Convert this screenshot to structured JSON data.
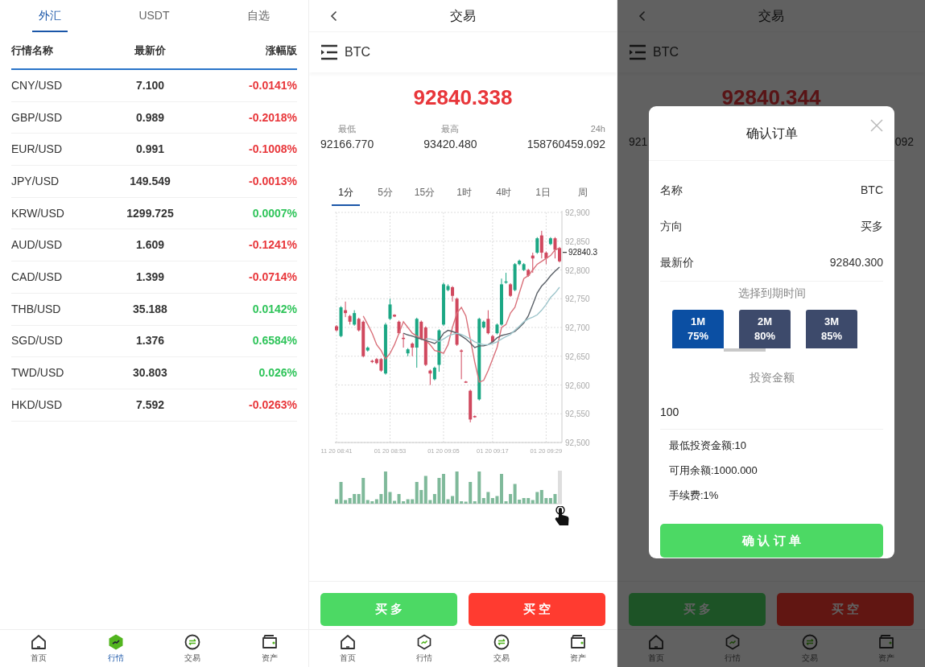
{
  "market": {
    "tabs": [
      {
        "label": "外汇",
        "selected": true
      },
      {
        "label": "USDT",
        "selected": false
      },
      {
        "label": "自选",
        "selected": false
      }
    ],
    "columns": [
      "行情名称",
      "最新价",
      "涨幅版"
    ],
    "rows": [
      {
        "name": "CNY/USD",
        "price": "7.100",
        "change": "-0.0141%",
        "color": "#e8363a"
      },
      {
        "name": "GBP/USD",
        "price": "0.989",
        "change": "-0.2018%",
        "color": "#e8363a"
      },
      {
        "name": "EUR/USD",
        "price": "0.991",
        "change": "-0.1008%",
        "color": "#e8363a"
      },
      {
        "name": "JPY/USD",
        "price": "149.549",
        "change": "-0.0013%",
        "color": "#e8363a"
      },
      {
        "name": "KRW/USD",
        "price": "1299.725",
        "change": "0.0007%",
        "color": "#2fc45a"
      },
      {
        "name": "AUD/USD",
        "price": "1.609",
        "change": "-0.1241%",
        "color": "#e8363a"
      },
      {
        "name": "CAD/USD",
        "price": "1.399",
        "change": "-0.0714%",
        "color": "#e8363a"
      },
      {
        "name": "THB/USD",
        "price": "35.188",
        "change": "0.0142%",
        "color": "#2fc45a"
      },
      {
        "name": "SGD/USD",
        "price": "1.376",
        "change": "0.6584%",
        "color": "#2fc45a"
      },
      {
        "name": "TWD/USD",
        "price": "30.803",
        "change": "0.026%",
        "color": "#2fc45a"
      },
      {
        "name": "HKD/USD",
        "price": "7.592",
        "change": "-0.0263%",
        "color": "#e8363a"
      }
    ],
    "nav": [
      {
        "label": "首页",
        "kind": "home",
        "selected": false
      },
      {
        "label": "行情",
        "kind": "market",
        "selected": true
      },
      {
        "label": "交易",
        "kind": "trade",
        "selected": false
      },
      {
        "label": "资产",
        "kind": "wallet",
        "selected": false
      }
    ]
  },
  "trade": {
    "title": "交易",
    "symbol": "BTC",
    "price": "92840.338",
    "stats": [
      {
        "label": "最低",
        "value": "92166.770"
      },
      {
        "label": "最高",
        "value": "93420.480"
      },
      {
        "label": "24h",
        "value": "158760459.092"
      }
    ],
    "intervals": [
      {
        "label": "1分",
        "selected": true
      },
      {
        "label": "5分",
        "selected": false
      },
      {
        "label": "15分",
        "selected": false
      },
      {
        "label": "1时",
        "selected": false
      },
      {
        "label": "4时",
        "selected": false
      },
      {
        "label": "1日",
        "selected": false
      },
      {
        "label": "周",
        "selected": false
      }
    ],
    "chart": {
      "last_price": "92840.3",
      "chart_data": {
        "type": "candlestick",
        "grid": true,
        "ylim": [
          92500,
          92900
        ],
        "categories": [
          "11 20 08:41",
          null,
          null,
          null,
          null,
          null,
          null,
          null,
          null,
          null,
          null,
          null,
          "01 20 08:53",
          null,
          null,
          null,
          null,
          null,
          null,
          null,
          null,
          null,
          null,
          null,
          "01 20 09:05",
          null,
          null,
          null,
          null,
          null,
          null,
          null,
          null,
          null,
          null,
          "01 20 09:17",
          null,
          null,
          null,
          null,
          null,
          null,
          null,
          null,
          null,
          null,
          null,
          "01 20 09:29",
          null,
          null,
          null
        ],
        "ohlc": [
          [
            92702,
            92704,
            92693,
            92695
          ],
          [
            92685,
            92737,
            92683,
            92735
          ],
          [
            92730,
            92745,
            92718,
            92725
          ],
          [
            92720,
            92722,
            92705,
            92710
          ],
          [
            92705,
            92730,
            92703,
            92725
          ],
          [
            92715,
            92717,
            92693,
            92695
          ],
          [
            92710,
            92712,
            92648,
            92650
          ],
          [
            92660,
            92667,
            92658,
            92665
          ],
          [
            92642,
            92644,
            92638,
            92640
          ],
          [
            92645,
            92647,
            92636,
            92638
          ],
          [
            92645,
            92647,
            92623,
            92625
          ],
          [
            92620,
            92708,
            92618,
            92705
          ],
          [
            92715,
            92750,
            92713,
            92740
          ],
          [
            92722,
            92723,
            92718,
            92719
          ],
          [
            92710,
            92712,
            92688,
            92690
          ],
          [
            92682,
            92690,
            92665,
            92680
          ],
          [
            92655,
            92664,
            92650,
            92662
          ],
          [
            92672,
            92674,
            92650,
            92665
          ],
          [
            92665,
            92717,
            92630,
            92715
          ],
          [
            92710,
            92712,
            92678,
            92680
          ],
          [
            92700,
            92702,
            92633,
            92635
          ],
          [
            92625,
            92627,
            92600,
            92620
          ],
          [
            92610,
            92632,
            92608,
            92630
          ],
          [
            92635,
            92697,
            92623,
            92695
          ],
          [
            92705,
            92778,
            92703,
            92775
          ],
          [
            92765,
            92775,
            92763,
            92772
          ],
          [
            92770,
            92772,
            92745,
            92755
          ],
          [
            92750,
            92752,
            92668,
            92670
          ],
          [
            92660,
            92662,
            92610,
            92658
          ],
          [
            92606,
            92607,
            92604,
            92605
          ],
          [
            92590,
            92592,
            92535,
            92540
          ],
          [
            92546,
            92547,
            92543,
            92544
          ],
          [
            92575,
            92717,
            92573,
            92715
          ],
          [
            92700,
            92712,
            92698,
            92710
          ],
          [
            92715,
            92730,
            92688,
            92690
          ],
          [
            92685,
            92687,
            92673,
            92675
          ],
          [
            92690,
            92707,
            92688,
            92705
          ],
          [
            92705,
            92785,
            92703,
            92775
          ],
          [
            92778,
            92795,
            92776,
            92780
          ],
          [
            92775,
            92777,
            92753,
            92755
          ],
          [
            92765,
            92812,
            92763,
            92810
          ],
          [
            92810,
            92818,
            92808,
            92816
          ],
          [
            92800,
            92812,
            92798,
            92810
          ],
          [
            92800,
            92802,
            92788,
            92790
          ],
          [
            92825,
            92830,
            92795,
            92820
          ],
          [
            92830,
            92857,
            92828,
            92855
          ],
          [
            92860,
            92868,
            92820,
            92830
          ],
          [
            92830,
            92832,
            92810,
            92820
          ],
          [
            92845,
            92857,
            92843,
            92855
          ],
          [
            92855,
            92857,
            92820,
            92835
          ],
          [
            92838,
            92840,
            92813,
            92815
          ]
        ],
        "yticks": [
          {
            "value": 92500,
            "label": "92,500"
          },
          {
            "value": 92550,
            "label": "92,550"
          },
          {
            "value": 92600,
            "label": "92,600"
          },
          {
            "value": 92650,
            "label": "92,650"
          },
          {
            "value": 92700,
            "label": "92,700"
          },
          {
            "value": 92750,
            "label": "92,750"
          },
          {
            "value": 92800,
            "label": "92,800"
          },
          {
            "value": 92850,
            "label": "92,850"
          },
          {
            "value": 92900,
            "label": "92,900"
          }
        ],
        "series": [
          {
            "type": "line",
            "color": "#d9707a",
            "values": [
              null,
              null,
              null,
              null,
              null,
              null,
              92720,
              92705,
              92690,
              92670,
              92660,
              92645,
              92655,
              92670,
              92690,
              92710,
              92700,
              92690,
              92685,
              92680,
              92678,
              92670,
              92660,
              92658,
              92655,
              92670,
              92700,
              92725,
              92735,
              92720,
              92680,
              92640,
              92605,
              92608,
              92625,
              92645,
              92665,
              92700,
              92705,
              92725,
              92735,
              92760,
              92785,
              92790,
              92800,
              92810,
              92815,
              92820,
              92825,
              92835,
              92838
            ]
          },
          {
            "type": "line",
            "color": "#5b6168",
            "values": [
              null,
              null,
              null,
              null,
              null,
              null,
              null,
              null,
              null,
              null,
              null,
              null,
              null,
              null,
              null,
              92690,
              92687,
              92685,
              92682,
              92680,
              92677,
              92675,
              92672,
              92678,
              92690,
              92695,
              92693,
              92690,
              92685,
              92680,
              92673,
              92665,
              92668,
              92668,
              92670,
              92675,
              92682,
              92686,
              92688,
              92690,
              92693,
              92700,
              92708,
              92720,
              92740,
              92760,
              92772,
              92780,
              92790,
              92798,
              92805
            ]
          },
          {
            "type": "line",
            "color": "#9fc6cc",
            "values": [
              null,
              null,
              null,
              null,
              null,
              null,
              null,
              null,
              null,
              null,
              null,
              null,
              null,
              null,
              null,
              null,
              null,
              null,
              null,
              null,
              92680,
              92680,
              92678,
              92676,
              92680,
              92685,
              92688,
              92690,
              92688,
              92684,
              92680,
              92675,
              92672,
              92670,
              92670,
              92672,
              92675,
              92680,
              92684,
              92688,
              92695,
              92702,
              92710,
              92715,
              92718,
              92722,
              92730,
              92740,
              92752,
              92760,
              92770
            ]
          }
        ]
      }
    },
    "actions": [
      {
        "label": "买 多",
        "kind": "long"
      },
      {
        "label": "买 空",
        "kind": "short"
      }
    ],
    "nav": [
      {
        "label": "首页",
        "kind": "home",
        "selected": false
      },
      {
        "label": "行情",
        "kind": "market",
        "selected": false
      },
      {
        "label": "交易",
        "kind": "trade",
        "selected": false
      },
      {
        "label": "资产",
        "kind": "wallet",
        "selected": false
      }
    ]
  },
  "order_screen": {
    "title": "交易",
    "symbol": "BTC",
    "price": "92840.344",
    "stats": [
      {
        "value": "921"
      },
      {
        "value": "092"
      }
    ],
    "actions": [
      {
        "label": "买 多",
        "kind": "long"
      },
      {
        "label": "买 空",
        "kind": "short"
      }
    ],
    "nav": [
      {
        "label": "首页",
        "kind": "home",
        "selected": false
      },
      {
        "label": "行情",
        "kind": "market",
        "selected": false
      },
      {
        "label": "交易",
        "kind": "trade",
        "selected": false
      },
      {
        "label": "资产",
        "kind": "wallet",
        "selected": false
      }
    ],
    "dialog": {
      "title": "确认订单",
      "rows": [
        {
          "label": "名称",
          "value": "BTC"
        },
        {
          "label": "方向",
          "value": "买多"
        },
        {
          "label": "最新价",
          "value": "92840.300"
        }
      ],
      "expiry_label": "选择到期时间",
      "expiry_options": [
        {
          "period": "1M",
          "rate": "75%",
          "selected": true
        },
        {
          "period": "2M",
          "rate": "80%",
          "selected": false
        },
        {
          "period": "3M",
          "rate": "85%",
          "selected": false
        }
      ],
      "amount_label": "投资金额",
      "amount_value": "100",
      "notes": [
        "最低投资金额:10",
        "可用余额:1000.000",
        "手续费:1%"
      ],
      "confirm": "确 认 订 单"
    }
  }
}
